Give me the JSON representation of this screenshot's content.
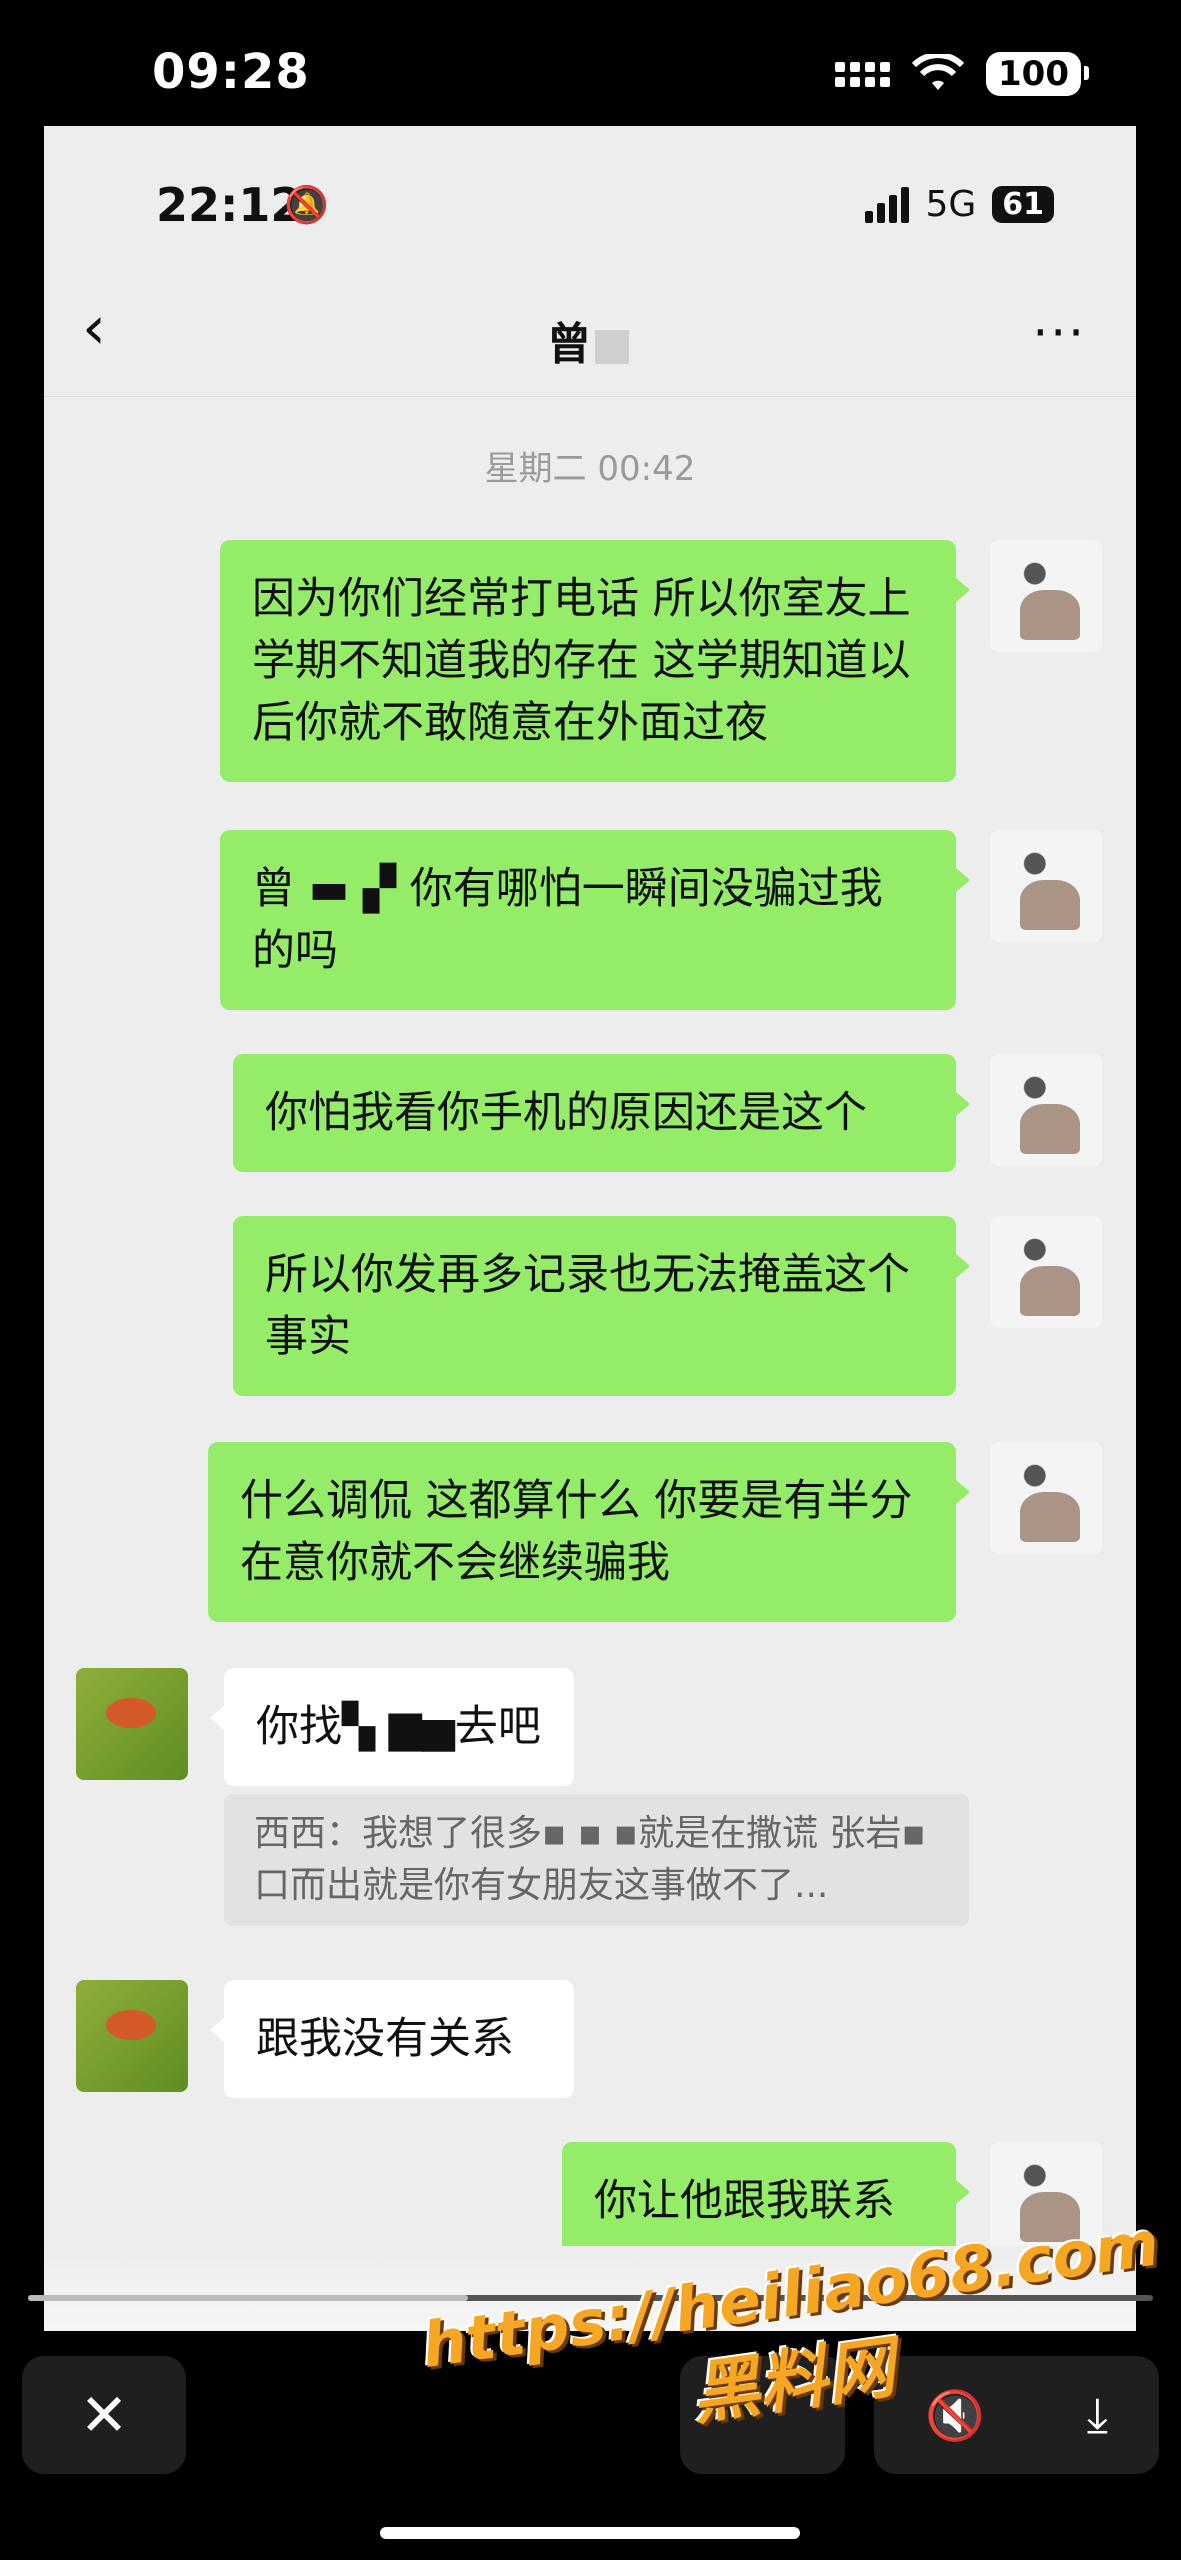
{
  "outer_status": {
    "time": "09:28",
    "battery": "100"
  },
  "inner_status": {
    "time": "22:12",
    "network": "5G",
    "battery": "61"
  },
  "nav": {
    "back": "‹",
    "contact": "曾",
    "contact_tail": "",
    "more": "···"
  },
  "timestamp": "星期二 00:42",
  "messages": [
    {
      "side": "me",
      "text": "因为你们经常打电话 所以你室友上学期不知道我的存在 这学期知道以后你就不敢随意在外面过夜"
    },
    {
      "side": "me",
      "text": "曾 ▬ ▞ 你有哪怕一瞬间没骗过我的吗"
    },
    {
      "side": "me",
      "text": "你怕我看你手机的原因还是这个"
    },
    {
      "side": "me",
      "text": "所以你发再多记录也无法掩盖这个事实"
    },
    {
      "side": "me",
      "text": "什么调侃 这都算什么 你要是有半分在意你就不会继续骗我"
    },
    {
      "side": "other",
      "text": "你找▚ ▆▅去吧"
    },
    {
      "side": "other_quote",
      "text": "西西：我想了很多▪ ▪ ▪就是在撒谎 张岩▪口而出就是你有女朋友这事做不了..."
    },
    {
      "side": "other",
      "text": "跟我没有关系"
    },
    {
      "side": "me",
      "text": "你让他跟我联系"
    }
  ],
  "controls": {
    "close": "✕",
    "mute": "🔇",
    "download": "⤓"
  },
  "watermark": {
    "url": "https://heiliao68.com",
    "name": "黑料网"
  }
}
